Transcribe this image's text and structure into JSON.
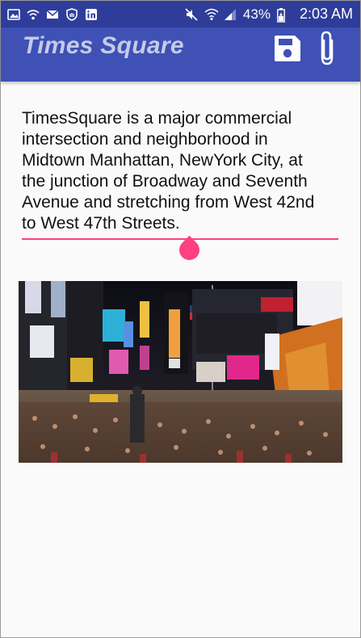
{
  "status_bar": {
    "battery": "43%",
    "time": "2:03 AM",
    "left_icons": [
      "gallery-icon",
      "wifi-call-icon",
      "email-icon",
      "shield-icon",
      "linkedin-icon"
    ],
    "right_icons": [
      "mute-icon",
      "wifi-icon",
      "signal-icon",
      "battery-icon"
    ]
  },
  "app_bar": {
    "title": "Times Square",
    "actions": [
      "save-icon",
      "attach-icon"
    ],
    "colors": {
      "primary": "#3f51b5",
      "dark": "#2f3d9a",
      "title": "#c5cae9"
    }
  },
  "editor": {
    "text": "TimesSquare is a major commercial\nintersection and neighborhood in\nMidtown Manhattan, NewYork City, at\nthe junction of Broadway and Seventh\nAvenue and stretching from West 42nd\nto West 47th Streets.",
    "accent": "#ff4081"
  },
  "image": {
    "subject": "times-square-photo"
  }
}
